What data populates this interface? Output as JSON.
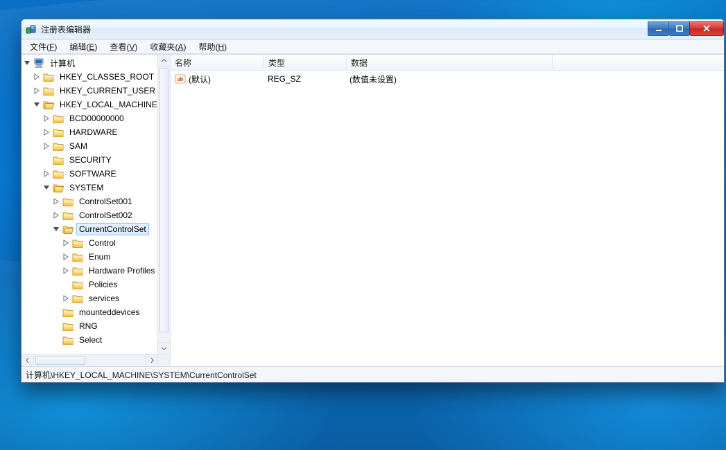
{
  "window": {
    "title": "注册表编辑器"
  },
  "menu": {
    "file": {
      "label": "文件",
      "mn": "F"
    },
    "edit": {
      "label": "编辑",
      "mn": "E"
    },
    "view": {
      "label": "查看",
      "mn": "V"
    },
    "fav": {
      "label": "收藏夹",
      "mn": "A"
    },
    "help": {
      "label": "帮助",
      "mn": "H"
    }
  },
  "tree": {
    "root": "计算机",
    "hkcr": "HKEY_CLASSES_ROOT",
    "hkcu": "HKEY_CURRENT_USER",
    "hklm": "HKEY_LOCAL_MACHINE",
    "hklm_children": {
      "bcd": "BCD00000000",
      "hardware": "HARDWARE",
      "sam": "SAM",
      "security": "SECURITY",
      "software": "SOFTWARE",
      "system": "SYSTEM"
    },
    "system_children": {
      "cs1": "ControlSet001",
      "cs2": "ControlSet002",
      "ccs": "CurrentControlSet",
      "mounteddevices": "mounteddevices",
      "rng": "RNG",
      "select": "Select"
    },
    "ccs_children": {
      "control": "Control",
      "enum": "Enum",
      "hwprofiles": "Hardware Profiles",
      "policies": "Policies",
      "services": "services"
    }
  },
  "columns": {
    "name": "名称",
    "type": "类型",
    "data": "数据"
  },
  "rows": [
    {
      "name": "(默认)",
      "type": "REG_SZ",
      "data": "(数值未设置)"
    }
  ],
  "status": {
    "path": "计算机\\HKEY_LOCAL_MACHINE\\SYSTEM\\CurrentControlSet"
  }
}
